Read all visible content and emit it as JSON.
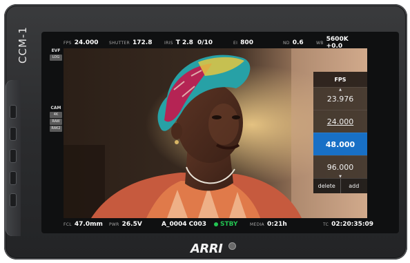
{
  "device": {
    "model_label": "CCM-1",
    "brand": "ARRI"
  },
  "top_status": {
    "fps": {
      "label": "FPS",
      "value": "24.000"
    },
    "shutter": {
      "label": "SHUTTER",
      "value": "172.8"
    },
    "iris": {
      "label": "IRIS",
      "value": "T 2.8",
      "extra": "0/10"
    },
    "ei": {
      "label": "EI",
      "value": "800"
    },
    "nd": {
      "label": "ND",
      "value": "0.6"
    },
    "wb": {
      "label": "WB",
      "value": "5600K +0.0"
    }
  },
  "left_panel": {
    "evf": {
      "title": "EVF",
      "tags": [
        "LOG"
      ]
    },
    "cam": {
      "title": "CAM",
      "tags": [
        "4K",
        "RAW",
        "RAK2"
      ]
    }
  },
  "fps_menu": {
    "title": "FPS",
    "options": [
      "23.976",
      "24.000",
      "48.000",
      "96.000"
    ],
    "current": "24.000",
    "selected": "48.000",
    "delete_label": "delete",
    "add_label": "add"
  },
  "bottom_status": {
    "fcl": {
      "label": "FCL",
      "value": "47.0mm"
    },
    "pwr": {
      "label": "PWR",
      "value": "26.5V"
    },
    "clip": {
      "value": "A_0004 C003"
    },
    "record_state": {
      "value": "STBY",
      "color": "#23c552"
    },
    "media": {
      "label": "MEDIA",
      "value": "0:21h"
    },
    "timecode": {
      "label": "TC",
      "value": "02:20:35:09"
    }
  },
  "colors": {
    "selection": "#1870c6",
    "status_ok": "#23c552"
  }
}
